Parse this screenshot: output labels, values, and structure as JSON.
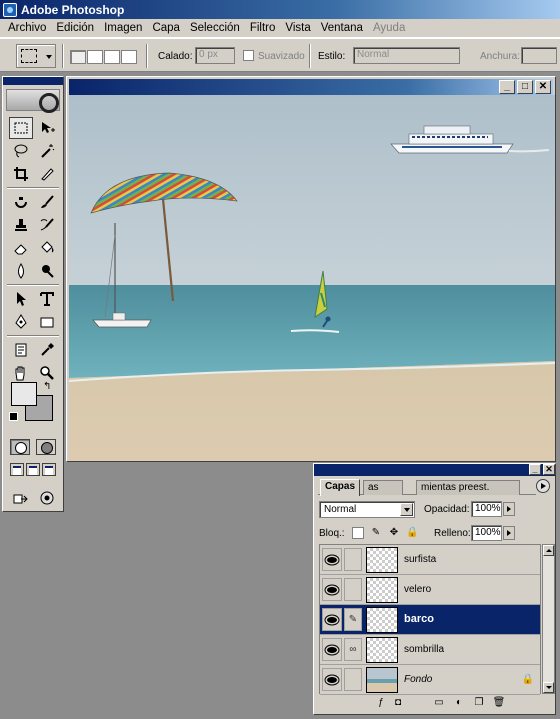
{
  "app": {
    "title": "Adobe Photoshop"
  },
  "menu": [
    "Archivo",
    "Edición",
    "Imagen",
    "Capa",
    "Selección",
    "Filtro",
    "Vista",
    "Ventana",
    "Ayuda"
  ],
  "options": {
    "feather_label": "Calado:",
    "feather_value": "0 px",
    "antialias_label": "Suavizado",
    "style_label": "Estilo:",
    "style_value": "Normal",
    "width_label": "Anchura:"
  },
  "layers_panel": {
    "tabs": [
      "Capas",
      "Canales",
      "Herramientas preest."
    ],
    "tabs_visible": [
      "Capas",
      "as",
      "mientas preest."
    ],
    "blend_mode": "Normal",
    "opacity_label": "Opacidad:",
    "opacity_value": "100%",
    "lock_label": "Bloq.:",
    "fill_label": "Relleno:",
    "fill_value": "100%",
    "layers": [
      {
        "name": "surfista",
        "selected": false
      },
      {
        "name": "velero",
        "selected": false
      },
      {
        "name": "barco",
        "selected": true
      },
      {
        "name": "sombrilla",
        "selected": false
      },
      {
        "name": "Fondo",
        "selected": false,
        "locked": true
      }
    ]
  },
  "colors": {
    "title_active": "#0a246a",
    "chrome": "#d4d0c8",
    "foreground": "#e8e8e8",
    "background": "#a7a7a7",
    "sky": "#b5c5cf",
    "sea": "#5e9fae",
    "sand": "#d8c7a9"
  }
}
